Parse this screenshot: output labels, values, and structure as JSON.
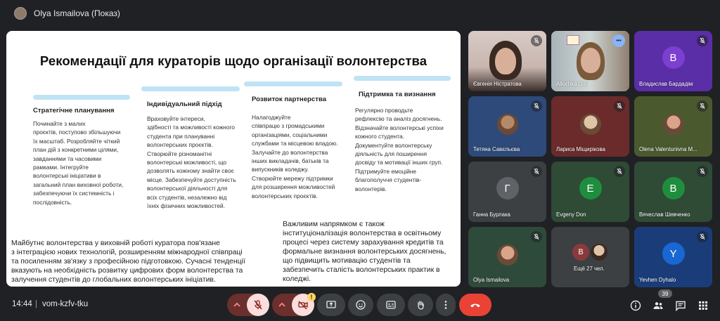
{
  "presenter": {
    "name": "Olya Ismailova (Показ)"
  },
  "slide": {
    "title": "Рекомендації для кураторів щодо організації волонтерства",
    "columns": [
      {
        "heading": "Стратегічне планування",
        "body": "Починайте з малих\nпроєктів, поступово збільшуючи\nїх масштаб. Розробляйте чіткий\nплан дій з конкретними цілями,\nзавданнями та часовими\nрамками. Інтегруйте\nволонтерські ініціативи в\nзагальний план виховної роботи,\nзабезпечуючи їх системність і\nпослідовність."
      },
      {
        "heading": "Індивідуальний підхід",
        "body": "Враховуйте інтереси,\nздібності та можливості кожного\nстудента при плануванні\nволонтерських проєктів.\nСтворюйте різноманітні\nволонтерські можливості, що\nдозволять кожному знайти своє\nмісце. Забезпечуйте доступність\nволонтерської діяльності для\nвсіх студентів, незалежно від\nїхніх фізичних можливостей."
      },
      {
        "heading": "Розвиток партнерства",
        "body": "Налагоджуйте\nспівпрацю з громадськими\nорганізаціями, соціальними\nслужбами та місцевою владою.\nЗалучайте до волонтерства\nінших викладачів, батьків та\nвипускників коледжу.\nСтворюйте мережу підтримки\nдля розширення можливостей\nволонтерських проєктів."
      },
      {
        "heading": "Підтримка та визнання",
        "body": "Регулярно проводьте\nрефлексію та аналіз досягнень.\nВідзначайте волонтерські успіхи\nкожного студента.\nДокументуйте волонтерську\nдіяльність для поширення\nдосвіду та мотивації інших груп.\nПідтримуйте емоційне\nблагополуччя студентів-\nволонтерів."
      }
    ],
    "footer_left": "Майбутнє волонтерства у виховній роботі куратора пов'язане\nз інтеграцією нових технологій, розширенням міжнародної співпраці\nта посиленням зв'язку з професійною підготовкою. Сучасні тенденції\nвказують на необхідність розвитку цифрових форм волонтерства та\nзалучення студентів до глобальних волонтерських ініціатив.",
    "footer_right": "Важливим напрямком є також\nінституціоналізація волонтерства в освітньому\nпроцесі через систему зарахування кредитів та\nформальне визнання волонтерських досягнень,\nщо підвищить мотивацію студентів та\nзабезпечить сталість волонтерських практик в\nколеджі."
  },
  "participants": [
    {
      "name": "Євгенія Ністратова",
      "kind": "video",
      "mic_off": true
    },
    {
      "name": "Allochka Don",
      "kind": "video",
      "active": true,
      "more": true
    },
    {
      "name": "Владислав Бардадім",
      "kind": "letter",
      "letter": "В",
      "color": "#7b3fd1",
      "bg": "#5a2ea6",
      "mic_off": true
    },
    {
      "name": "Тетяна Савєльєва",
      "kind": "photo",
      "bg": "#2d4a7a",
      "mic_off": true
    },
    {
      "name": "Лариса Міщирікова",
      "kind": "photo",
      "bg": "#6b2b2b",
      "mic_off": true
    },
    {
      "name": "Olena Valentunivna M...",
      "kind": "photo",
      "bg": "#4a5a2e",
      "mic_off": true
    },
    {
      "name": "Ганна Бурлака",
      "kind": "letter",
      "letter": "Г",
      "color": "#5f6368",
      "bg": "#3c4043",
      "mic_off": true
    },
    {
      "name": "Evgeny Don",
      "kind": "letter",
      "letter": "Е",
      "color": "#1e8e3e",
      "bg": "#2f4a35",
      "mic_off": true
    },
    {
      "name": "Вячеслав Шевченко",
      "kind": "letter",
      "letter": "В",
      "color": "#1e8e3e",
      "bg": "#2f4a35",
      "mic_off": true
    },
    {
      "name": "Olya Ismailova",
      "kind": "photo",
      "bg": "#2e4a3a",
      "mic_off": true
    },
    {
      "name": "Ещё 27 чел.",
      "kind": "others",
      "letter": "В",
      "bg": "#3c4043"
    },
    {
      "name": "Yevhen Dyhalo",
      "kind": "letter",
      "letter": "Y",
      "color": "#1967d2",
      "bg": "#1a3d7a",
      "mic_off": true
    }
  ],
  "bottombar": {
    "time": "14:44",
    "separator": "|",
    "meeting_code": "vom-kzfv-tku",
    "participant_count": "39",
    "warning_badge": "!"
  },
  "colors": {
    "hangup": "#ea4335",
    "muted_control": "#f9dedc",
    "active_outline": "#a8c7fa"
  }
}
